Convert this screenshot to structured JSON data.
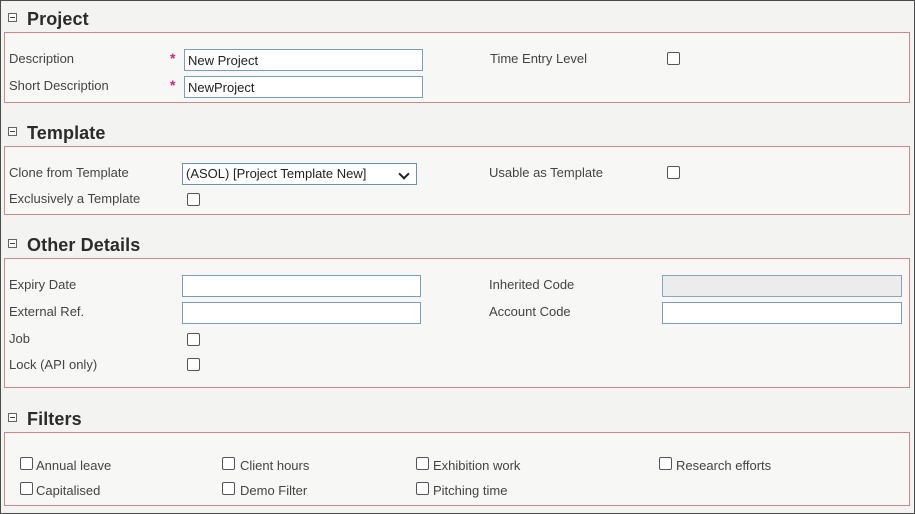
{
  "sections": {
    "project": {
      "title": "Project",
      "description_label": "Description",
      "description_value": "New Project",
      "short_description_label": "Short Description",
      "short_description_value": "NewProject",
      "required_marker": "*",
      "time_entry_level_label": "Time Entry Level"
    },
    "template": {
      "title": "Template",
      "clone_label": "Clone from Template",
      "clone_value": "(ASOL) [Project Template New]",
      "usable_label": "Usable as Template",
      "exclusive_label": "Exclusively a Template"
    },
    "other": {
      "title": "Other Details",
      "expiry_label": "Expiry Date",
      "expiry_value": "",
      "external_ref_label": "External Ref.",
      "external_ref_value": "",
      "job_label": "Job",
      "lock_label": "Lock (API only)",
      "inherited_code_label": "Inherited Code",
      "inherited_code_value": "",
      "account_code_label": "Account Code",
      "account_code_value": ""
    },
    "filters": {
      "title": "Filters",
      "items": [
        "Annual leave",
        "Client hours",
        "Exhibition work",
        "Research efforts",
        "Capitalised",
        "Demo Filter",
        "Pitching time"
      ]
    }
  },
  "colors": {
    "panel_border": "#c98a8a",
    "input_border": "#7a9cc0",
    "required": "#d0237a",
    "background": "#f3f3f1"
  }
}
